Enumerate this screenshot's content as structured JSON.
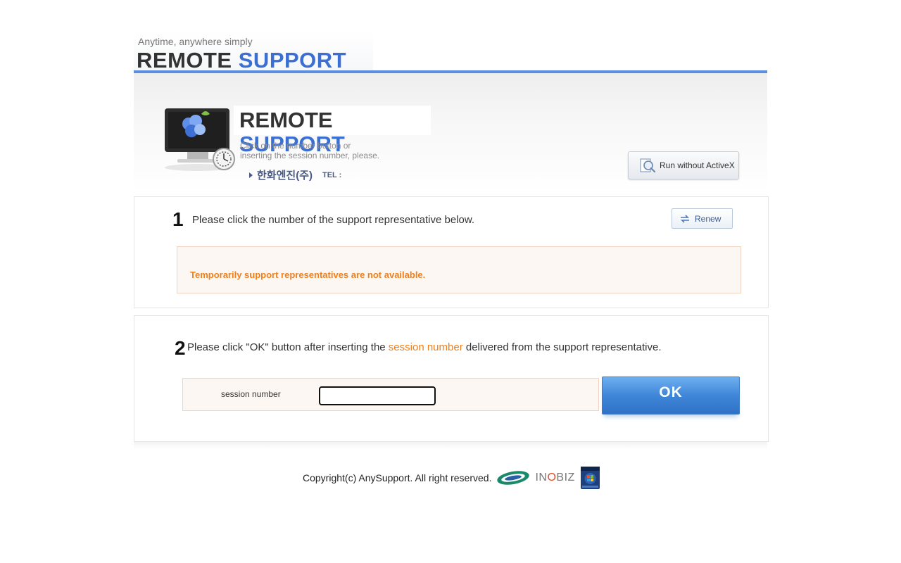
{
  "header": {
    "tagline": "Anytime, anywhere simply",
    "logo_part1": "REMOTE",
    "logo_part2": "SUPPORT"
  },
  "hero": {
    "title_part1": "REMOTE",
    "title_part2": "SUPPORT",
    "desc_line1": "Click on the number button or",
    "desc_line2": "inserting the session number, please.",
    "company": "한화엔진(주)",
    "tel_label": "TEL :",
    "run_button_label": "Run without ActiveX",
    "icons": [
      "monitor-icon",
      "magnifier-icon"
    ]
  },
  "step1": {
    "number": "1",
    "text": "Please click the number of the support representative below.",
    "renew_label": "Renew",
    "notice": "Temporarily support representatives are not available."
  },
  "step2": {
    "number": "2",
    "text_before": "Please click \"OK\" button after inserting the ",
    "text_highlight": "session number",
    "text_after": " delivered from the support representative.",
    "session_label": "session number",
    "session_value": "",
    "ok_label": "OK"
  },
  "footer": {
    "copyright": "Copyright(c) AnySupport. All right reserved.",
    "innobiz_part1": "IN",
    "innobiz_part2": "O",
    "innobiz_part3": "BIZ"
  },
  "colors": {
    "accent_blue": "#3b6fd1",
    "highlight_orange": "#f07f1a",
    "ok_button_blue": "#3f86d8"
  }
}
